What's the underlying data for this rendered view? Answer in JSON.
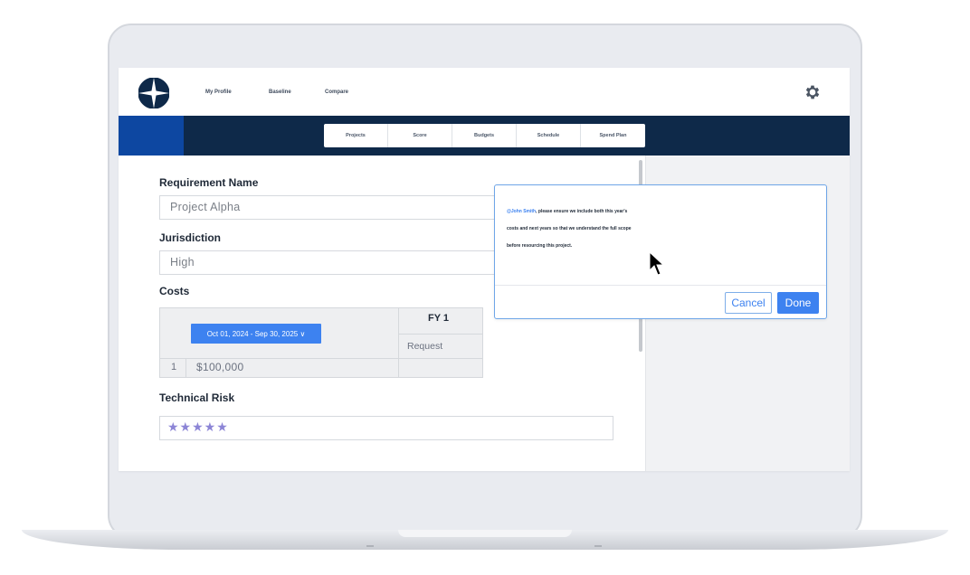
{
  "topnav": {
    "items": [
      "My Profile",
      "Baseline",
      "Compare"
    ]
  },
  "tabs": [
    "Projects",
    "Score",
    "Budgets",
    "Schedule",
    "Spend Plan"
  ],
  "form": {
    "requirement_label": "Requirement Name",
    "requirement_value": "Project Alpha",
    "jurisdiction_label": "Jurisdiction",
    "jurisdiction_value": "High",
    "costs_label": "Costs",
    "costs_table": {
      "date_range": "Oct 01, 2024 - Sep 30, 2025 ∨",
      "column_header": "FY 1",
      "sub_header": "Request",
      "rows": [
        {
          "num": "1",
          "value": "$100,000"
        }
      ]
    },
    "technical_risk_label": "Technical Risk",
    "technical_risk_stars": "★★★★★",
    "technical_risk_rating": 5
  },
  "comment_popup": {
    "mention": "@John Smith",
    "line1_rest": ", please ensure we include both this year's",
    "line2": "costs and next years so that we understand the full scope",
    "line3": "before resourcing this project.",
    "cancel_label": "Cancel",
    "done_label": "Done"
  },
  "colors": {
    "header_bar": "#0e2949",
    "accent_blue": "#3d82f0",
    "star_color": "#8c85d6"
  },
  "icons": [
    "logo-icon",
    "gear-icon",
    "cursor-icon"
  ]
}
